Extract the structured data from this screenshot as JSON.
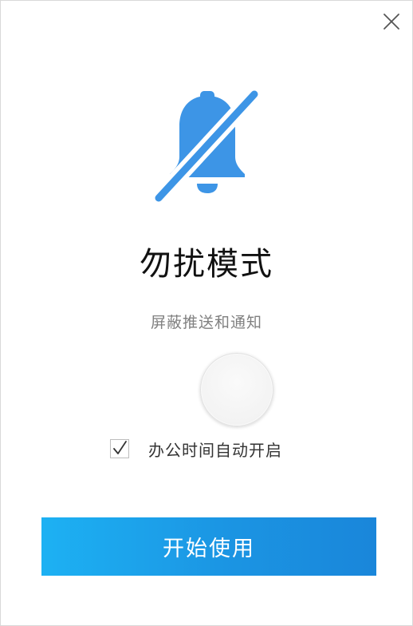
{
  "window": {
    "close_icon": "close-icon"
  },
  "hero": {
    "icon": "bell-off-icon",
    "icon_color": "#3d95e6"
  },
  "title": "勿扰模式",
  "subtitle": "屏蔽推送和通知",
  "toggle": {
    "state": "off"
  },
  "auto_enable": {
    "label": "办公时间自动开启",
    "checked": true
  },
  "start_button": {
    "label": "开始使用",
    "gradient_start": "#1db1f3",
    "gradient_end": "#1a86da"
  }
}
